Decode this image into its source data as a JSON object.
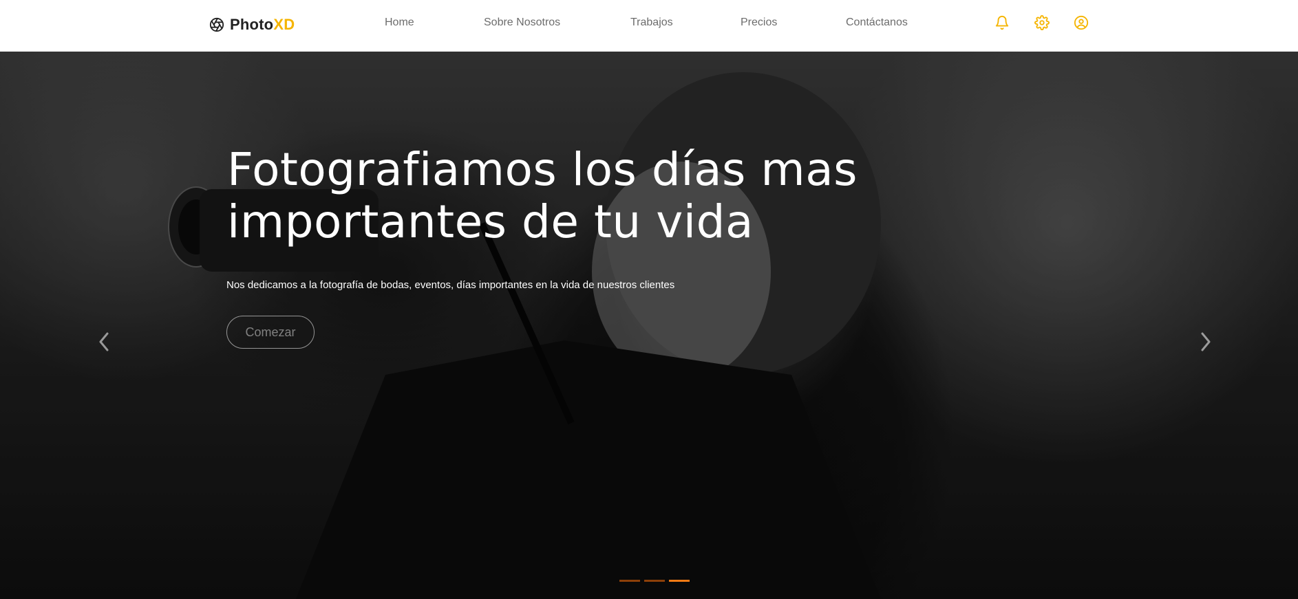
{
  "brand": {
    "name_main": "Photo",
    "name_accent": "XD",
    "logo_icon": "aperture-icon"
  },
  "nav": {
    "links": [
      "Home",
      "Sobre Nosotros",
      "Trabajos",
      "Precios",
      "Contáctanos"
    ],
    "icons": [
      "bell-icon",
      "gear-icon",
      "user-circle-icon"
    ]
  },
  "hero": {
    "title": "Fotografiamos los días mas importantes de tu vida",
    "subtitle": "Nos dedicamos a la fotografía de bodas, eventos, días importantes en la vida de nuestros clientes",
    "cta_label": "Comezar",
    "slides_count": 3,
    "active_slide": 3
  },
  "colors": {
    "accent": "#f5b400",
    "indicator": "#f07a14",
    "nav_text": "#6c6c6c"
  }
}
